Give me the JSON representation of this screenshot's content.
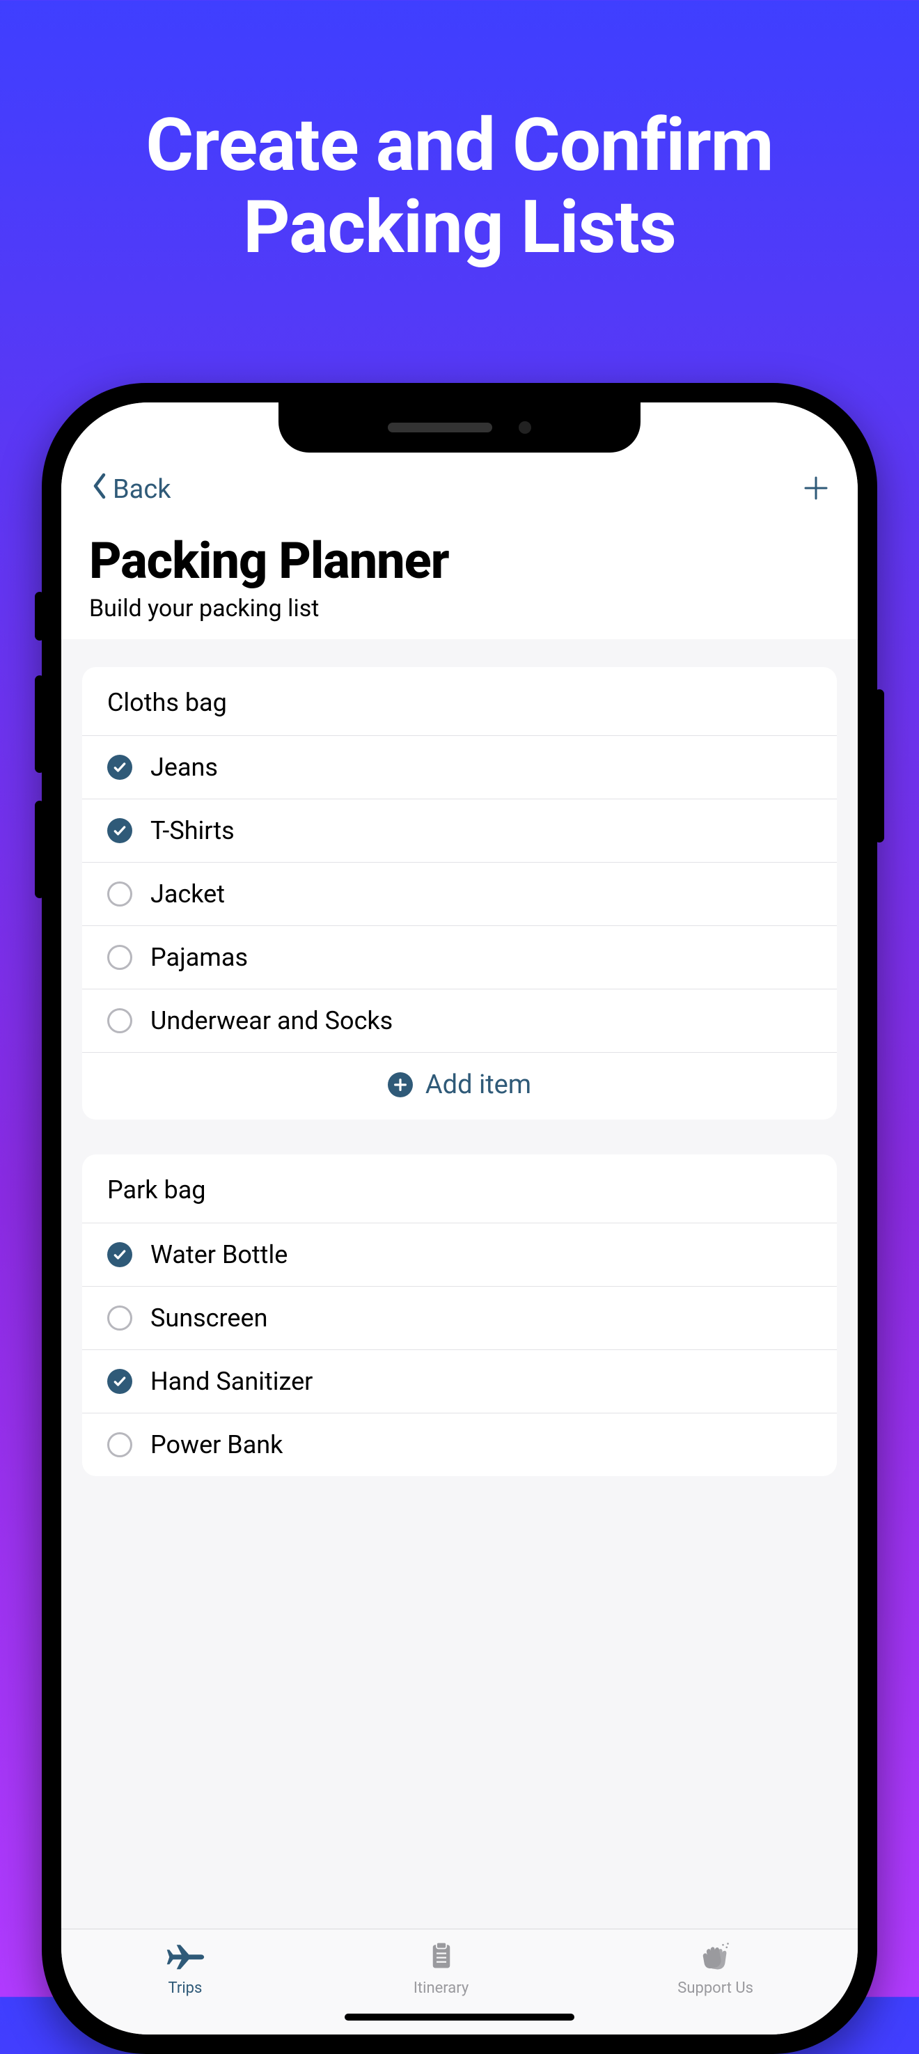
{
  "hero": {
    "line1": "Create and Confirm",
    "line2": "Packing Lists"
  },
  "nav": {
    "back_label": "Back"
  },
  "page": {
    "title": "Packing Planner",
    "subtitle": "Build your packing list"
  },
  "add_item_label": "Add item",
  "sections": [
    {
      "title": "Cloths bag",
      "items": [
        {
          "label": "Jeans",
          "checked": true
        },
        {
          "label": "T-Shirts",
          "checked": true
        },
        {
          "label": "Jacket",
          "checked": false
        },
        {
          "label": "Pajamas",
          "checked": false
        },
        {
          "label": "Underwear and Socks",
          "checked": false
        }
      ],
      "show_add": true
    },
    {
      "title": "Park bag",
      "items": [
        {
          "label": "Water Bottle",
          "checked": true
        },
        {
          "label": "Sunscreen",
          "checked": false
        },
        {
          "label": "Hand Sanitizer",
          "checked": true
        },
        {
          "label": "Power Bank",
          "checked": false
        }
      ],
      "show_add": false
    }
  ],
  "tabs": [
    {
      "label": "Trips",
      "icon": "plane",
      "active": true
    },
    {
      "label": "Itinerary",
      "icon": "clipboard",
      "active": false
    },
    {
      "label": "Support Us",
      "icon": "clap",
      "active": false
    }
  ],
  "colors": {
    "accent": "#2F5A78",
    "bg_top": "#3F3FFF",
    "bg_bottom": "#B13BFF"
  }
}
